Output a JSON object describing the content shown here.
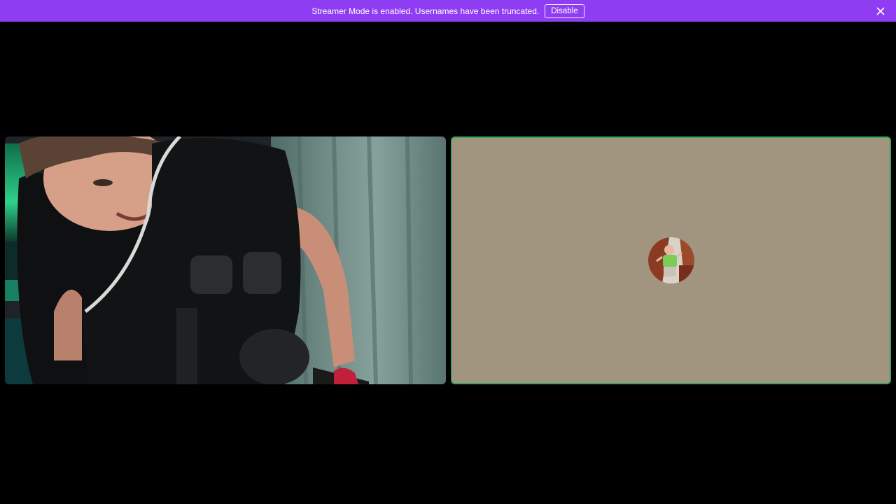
{
  "notice_bar": {
    "message": "Streamer Mode is enabled. Usernames have been truncated.",
    "disable_label": "Disable",
    "close_icon": "close-icon",
    "bg_color": "#8f3df2"
  },
  "call": {
    "tiles": [
      {
        "kind": "camera",
        "content": "webcam video feed"
      },
      {
        "kind": "avatar",
        "speaking": true,
        "speaking_ring_color": "#3ba55d",
        "bg_color": "#a19580"
      }
    ]
  }
}
